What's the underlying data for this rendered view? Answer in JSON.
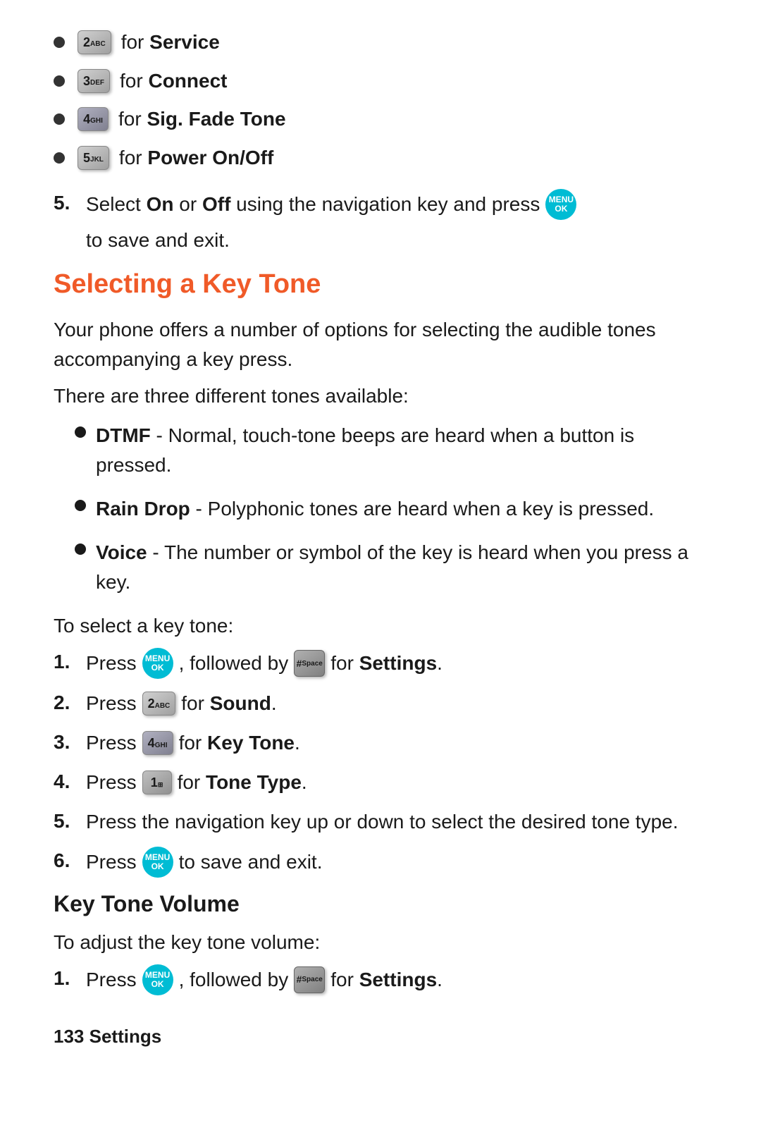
{
  "top_bullets": [
    {
      "key_main": "2",
      "key_sub": "ABC",
      "label": "for ",
      "bold": "Service"
    },
    {
      "key_main": "3",
      "key_sub": "DEF",
      "label": "for ",
      "bold": "Connect"
    },
    {
      "key_main": "4",
      "key_sub": "GHI",
      "label": "for ",
      "bold": "Sig. Fade Tone"
    },
    {
      "key_main": "5",
      "key_sub": "JKL",
      "label": "for ",
      "bold": "Power On/Off"
    }
  ],
  "step5_text": "Select ",
  "step5_on": "On",
  "step5_or": " or ",
  "step5_off": "Off",
  "step5_rest": " using the navigation key and press",
  "step5_end": "to save and exit.",
  "section1_title": "Selecting a Key Tone",
  "intro1": "Your phone offers a number of options for selecting the audible tones accompanying a key press.",
  "intro2": "There are three different tones available:",
  "tones": [
    {
      "bold": "DTMF",
      "text": " - Normal, touch-tone beeps are heard when a button is pressed."
    },
    {
      "bold": "Rain Drop",
      "text": " - Polyphonic tones are heard when a key is pressed."
    },
    {
      "bold": "Voice",
      "text": " - The number or symbol of the key is heard when you press a key."
    }
  ],
  "to_select": "To select a key tone:",
  "steps1": [
    {
      "num": "1.",
      "pre": "Press",
      "btn_type": "menu",
      "mid": ", followed by",
      "btn2_type": "hash",
      "post_bold": "Settings",
      "post_pre": "for"
    },
    {
      "num": "2.",
      "pre": "Press",
      "btn_type": "key2",
      "post_pre": "for",
      "post_bold": "Sound",
      "post": "."
    },
    {
      "num": "3.",
      "pre": "Press",
      "btn_type": "key4",
      "post_pre": "for",
      "post_bold": "Key Tone",
      "post": "."
    },
    {
      "num": "4.",
      "pre": "Press",
      "btn_type": "key1",
      "post_pre": "for",
      "post_bold": "Tone Type",
      "post": "."
    },
    {
      "num": "5.",
      "text": "Press the navigation key up or down to select the desired tone type."
    },
    {
      "num": "6.",
      "pre": "Press",
      "btn_type": "menu",
      "post": "to save and exit."
    }
  ],
  "section2_title": "Key Tone Volume",
  "to_adjust": "To adjust the key tone volume:",
  "steps2": [
    {
      "num": "1.",
      "pre": "Press",
      "btn_type": "menu",
      "mid": ", followed by",
      "btn2_type": "hash",
      "post_bold": "Settings",
      "post_pre": "for"
    }
  ],
  "footer": "133   Settings",
  "menu_label": "MENU\nOK",
  "hash_label": "#\nSpace"
}
